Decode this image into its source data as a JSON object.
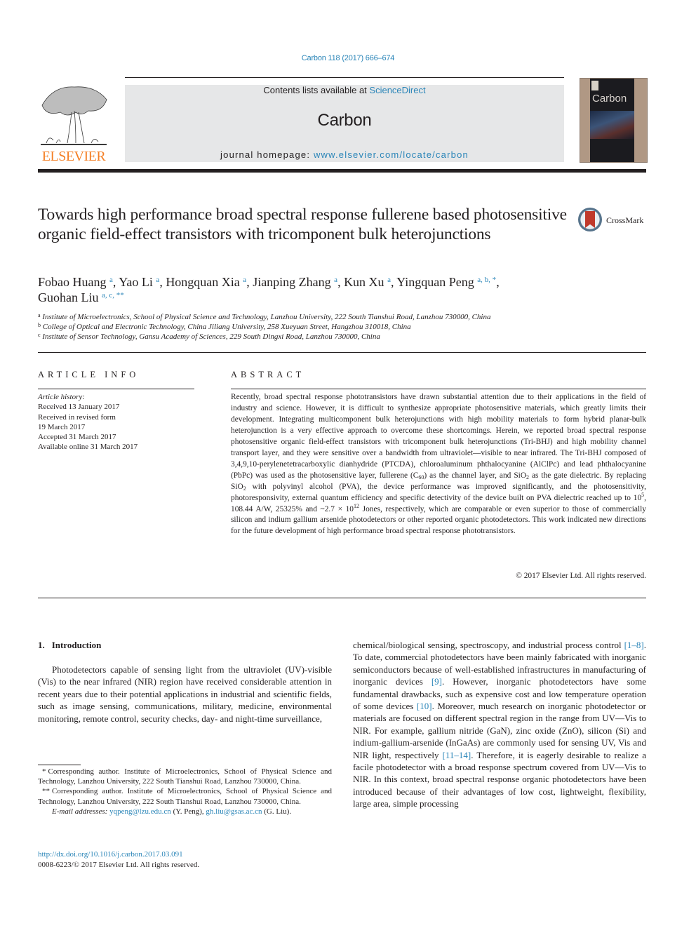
{
  "header": {
    "journal_ref": "Carbon 118 (2017) 666–674",
    "contents_prefix": "Contents lists available at ",
    "contents_link": "ScienceDirect",
    "journal_name": "Carbon",
    "homepage_prefix": "journal homepage: ",
    "homepage_link": "www.elsevier.com/locate/carbon",
    "publisher_logo_text": "ELSEVIER",
    "cover_title": "Carbon",
    "crossmark_label": "CrossMark",
    "colors": {
      "link": "#2a85b8",
      "elsevier_orange": "#f47f25",
      "masthead_bg": "#e6e7e8"
    }
  },
  "article": {
    "title": "Towards high performance broad spectral response fullerene based photosensitive organic field-effect transistors with tricomponent bulk heterojunctions",
    "authors": [
      {
        "name": "Fobao Huang",
        "sup": "a"
      },
      {
        "name": "Yao Li",
        "sup": "a"
      },
      {
        "name": "Hongquan Xia",
        "sup": "a"
      },
      {
        "name": "Jianping Zhang",
        "sup": "a"
      },
      {
        "name": "Kun Xu",
        "sup": "a"
      },
      {
        "name": "Yingquan Peng",
        "sup": "a, b, *"
      },
      {
        "name": "Guohan Liu",
        "sup": "a, c, **"
      }
    ],
    "affiliations": [
      {
        "mark": "a",
        "text": "Institute of Microelectronics, School of Physical Science and Technology, Lanzhou University, 222 South Tianshui Road, Lanzhou 730000, China"
      },
      {
        "mark": "b",
        "text": "College of Optical and Electronic Technology, China Jiliang University, 258 Xueyuan Street, Hangzhou 310018, China"
      },
      {
        "mark": "c",
        "text": "Institute of Sensor Technology, Gansu Academy of Sciences, 229 South Dingxi Road, Lanzhou 730000, China"
      }
    ]
  },
  "article_info": {
    "heading": "ARTICLE INFO",
    "history_label": "Article history:",
    "history": [
      "Received 13 January 2017",
      "Received in revised form",
      "19 March 2017",
      "Accepted 31 March 2017",
      "Available online 31 March 2017"
    ]
  },
  "abstract": {
    "heading": "ABSTRACT",
    "segments": [
      {
        "t": "Recently, broad spectral response phototransistors have drawn substantial attention due to their applications in the field of industry and science. However, it is difficult to synthesize appropriate photosensitive materials, which greatly limits their development. Integrating multicomponent bulk heterojunctions with high mobility materials to form hybrid planar-bulk heterojunction is a very effective approach to overcome these shortcomings. Herein, we reported broad spectral response photosensitive organic field-effect transistors with tricomponent bulk heterojunctions (Tri-BHJ) and high mobility channel transport layer, and they were sensitive over a bandwidth from ultraviolet—visible to near infrared. The Tri-BHJ composed of 3,4,9,10-perylenetetracarboxylic dianhydride (PTCDA), chloroaluminum phthalocyanine (AlClPc) and lead phthalocyanine (PbPc) was used as the photosensitive layer, fullerene (C"
      },
      {
        "sub": "60"
      },
      {
        "t": ") as the channel layer, and SiO"
      },
      {
        "sub": "2"
      },
      {
        "t": " as the gate dielectric. By replacing SiO"
      },
      {
        "sub": "2"
      },
      {
        "t": " with polyvinyl alcohol (PVA), the device performance was improved significantly, and the photosensitivity, photoresponsivity, external quantum efficiency and specific detectivity of the device built on PVA dielectric reached up to 10"
      },
      {
        "sup": "5"
      },
      {
        "t": ", 108.44 A/W, 25325% and ~2.7 × 10"
      },
      {
        "sup": "12"
      },
      {
        "t": " Jones, respectively, which are comparable or even superior to those of commercially silicon and indium gallium arsenide photodetectors or other reported organic photodetectors. This work indicated new directions for the future development of high performance broad spectral response phototransistors."
      }
    ],
    "copyright": "© 2017 Elsevier Ltd. All rights reserved."
  },
  "introduction": {
    "number": "1.",
    "heading": "Introduction",
    "p1": "Photodetectors capable of sensing light from the ultraviolet (UV)-visible (Vis) to the near infrared (NIR) region have received considerable attention in recent years due to their potential applications in industrial and scientific fields, such as image sensing, communications, military, medicine, environmental monitoring, remote control, security checks, day- and night-time surveillance,",
    "p2_segments": [
      {
        "t": "chemical/biological sensing, spectroscopy, and industrial process control "
      },
      {
        "ref": "[1–8]"
      },
      {
        "t": ". To date, commercial photodetectors have been mainly fabricated with inorganic semiconductors because of well-established infrastructures in manufacturing of inorganic devices "
      },
      {
        "ref": "[9]"
      },
      {
        "t": ". However, inorganic photodetectors have some fundamental drawbacks, such as expensive cost and low temperature operation of some devices "
      },
      {
        "ref": "[10]"
      },
      {
        "t": ". Moreover, much research on inorganic photodetector or materials are focused on different spectral region in the range from UV—Vis to NIR. For example, gallium nitride (GaN), zinc oxide (ZnO), silicon (Si) and indium-gallium-arsenide (InGaAs) are commonly used for sensing UV, Vis and NIR light, respectively "
      },
      {
        "ref": "[11–14]"
      },
      {
        "t": ". Therefore, it is eagerly desirable to realize a facile photodetector with a broad response spectrum covered from UV—Vis to NIR. In this context, broad spectral response organic photodetectors have been introduced because of their advantages of low cost, lightweight, flexibility, large area, simple processing"
      }
    ]
  },
  "footnotes": {
    "items": [
      {
        "mark": "*",
        "text": "Corresponding author. Institute of Microelectronics, School of Physical Science and Technology, Lanzhou University, 222 South Tianshui Road, Lanzhou 730000, China."
      },
      {
        "mark": "**",
        "text": "Corresponding author. Institute of Microelectronics, School of Physical Science and Technology, Lanzhou University, 222 South Tianshui Road, Lanzhou 730000, China."
      }
    ],
    "email_label": "E-mail addresses:",
    "email_1": "yqpeng@lzu.edu.cn",
    "email_1_owner": " (Y. Peng), ",
    "email_2": "gh.liu@gsas.ac.cn",
    "email_2_owner": " (G. Liu)."
  },
  "doi": {
    "link": "http://dx.doi.org/10.1016/j.carbon.2017.03.091",
    "issn_line": "0008-6223/© 2017 Elsevier Ltd. All rights reserved."
  }
}
